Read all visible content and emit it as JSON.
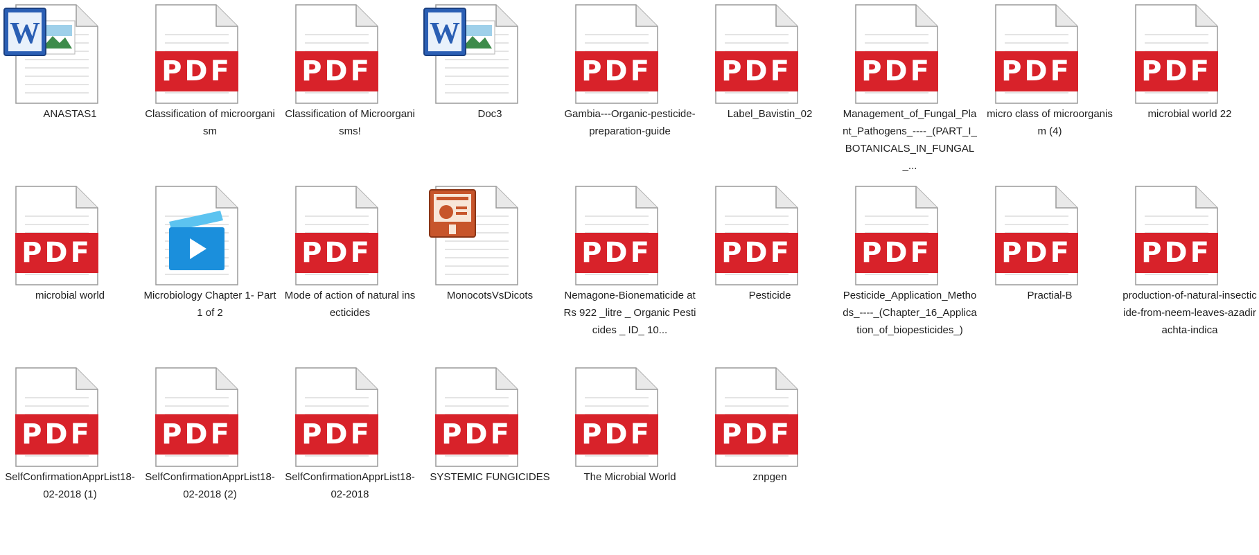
{
  "window": {
    "view": "Large icons"
  },
  "pdf_badge_text": "PDF",
  "colors": {
    "pdf_red": "#d8222a",
    "word_blue": "#2b5fb4",
    "ppt_orange": "#c7552b",
    "video_blue": "#1b8fdc"
  },
  "files": [
    {
      "name": "ANASTAS1",
      "type": "word-old"
    },
    {
      "name": "Classification of microorganism",
      "type": "pdf"
    },
    {
      "name": "Classification of Microorganisms!",
      "type": "pdf"
    },
    {
      "name": "Doc3",
      "type": "word"
    },
    {
      "name": "Gambia---Organic-pesticide-preparation-guide",
      "type": "pdf"
    },
    {
      "name": "Label_Bavistin_02",
      "type": "pdf"
    },
    {
      "name": "Management_of_Fungal_Plant_Pathogens_----_(PART_I_BOTANICALS_IN_FUNGAL_...",
      "type": "pdf"
    },
    {
      "name": "micro class of microorganism (4)",
      "type": "pdf"
    },
    {
      "name": "microbial world 22",
      "type": "pdf"
    },
    {
      "name": "microbial world",
      "type": "pdf"
    },
    {
      "name": "Microbiology Chapter 1- Part 1 of 2",
      "type": "video"
    },
    {
      "name": "Mode of action of natural insecticides",
      "type": "pdf"
    },
    {
      "name": "MonocotsVsDicots",
      "type": "powerpoint"
    },
    {
      "name": "Nemagone-Bionematicide at Rs 922 _litre _ Organic Pesticides _ ID_ 10...",
      "type": "pdf"
    },
    {
      "name": "Pesticide",
      "type": "pdf"
    },
    {
      "name": "Pesticide_Application_Methods_----_(Chapter_16_Application_of_biopesticides_)",
      "type": "pdf"
    },
    {
      "name": "Practial-B",
      "type": "pdf"
    },
    {
      "name": "production-of-natural-insecticide-from-neem-leaves-azadirachta-indica",
      "type": "pdf"
    },
    {
      "name": "SelfConfirmationApprList18-02-2018 (1)",
      "type": "pdf"
    },
    {
      "name": "SelfConfirmationApprList18-02-2018 (2)",
      "type": "pdf"
    },
    {
      "name": "SelfConfirmationApprList18-02-2018",
      "type": "pdf"
    },
    {
      "name": "SYSTEMIC FUNGICIDES",
      "type": "pdf"
    },
    {
      "name": "The Microbial World",
      "type": "pdf"
    },
    {
      "name": "znpgen",
      "type": "pdf"
    }
  ]
}
